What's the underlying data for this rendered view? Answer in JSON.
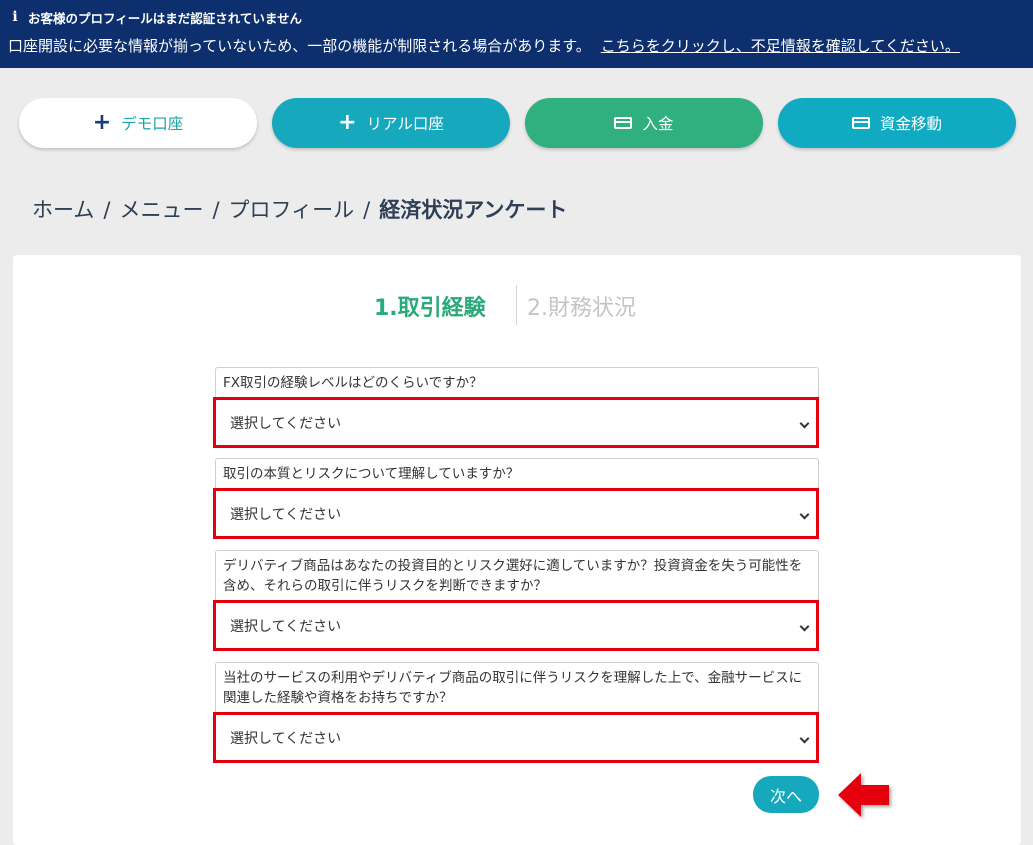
{
  "notice": {
    "title": "お客様のプロフィールはまだ認証されていません",
    "message": "口座開設に必要な情報が揃っていないため、一部の機能が制限される場合があります。",
    "link": "こちらをクリックし、不足情報を確認してください。",
    "icon": "info-icon"
  },
  "actions": {
    "demo": "デモ口座",
    "real": "リアル口座",
    "deposit": "入金",
    "transfer": "資金移動"
  },
  "breadcrumb": {
    "home": "ホーム",
    "menu": "メニュー",
    "profile": "プロフィール",
    "current": "経済状況アンケート",
    "separator": "/"
  },
  "steps": {
    "step1": "1.取引経験",
    "step2": "2.財務状況"
  },
  "questions": [
    {
      "label": "FX取引の経験レベルはどのくらいですか？",
      "value": "選択してください"
    },
    {
      "label": "取引の本質とリスクについて理解していますか？",
      "value": "選択してください"
    },
    {
      "label": "デリバティブ商品はあなたの投資目的とリスク選好に適していますか？投資資金を失う可能性を含め、それらの取引に伴うリスクを判断できますか？",
      "value": "選択してください"
    },
    {
      "label": "当社のサービスの利用やデリバティブ商品の取引に伴うリスクを理解した上で、金融サービスに関連した経験や資格をお持ちですか？",
      "value": "選択してください"
    }
  ],
  "next_label": "次へ",
  "colors": {
    "banner": "#0d2f6e",
    "accent": "#16a9bd",
    "green": "#2fb07e",
    "highlight": "#e4000f"
  }
}
